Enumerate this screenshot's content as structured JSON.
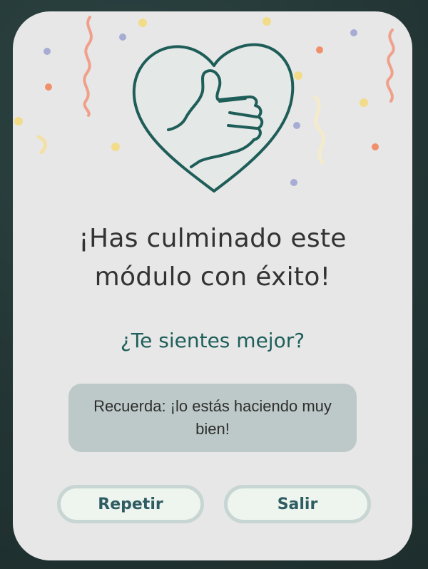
{
  "screen": {
    "title_line1": "¡Has culminado este",
    "title_line2": "módulo con éxito!",
    "question": "¿Te sientes mejor?",
    "reminder": "Recuerda: ¡lo estás haciendo muy bien!",
    "buttons": {
      "repeat_label": "Repetir",
      "exit_label": "Salir"
    }
  },
  "illustration": {
    "icon": "thumbs-up-heart-icon",
    "decoration": "confetti"
  },
  "colors": {
    "background": "#263a39",
    "card": "#e7e7e7",
    "title_text": "#333333",
    "question_text": "#1f5f5b",
    "reminder_bg": "#bdc9c8",
    "button_bg": "#eef5ee",
    "button_border": "#c7d6d3",
    "button_text": "#2f5c63",
    "icon_stroke": "#1e5d58"
  }
}
